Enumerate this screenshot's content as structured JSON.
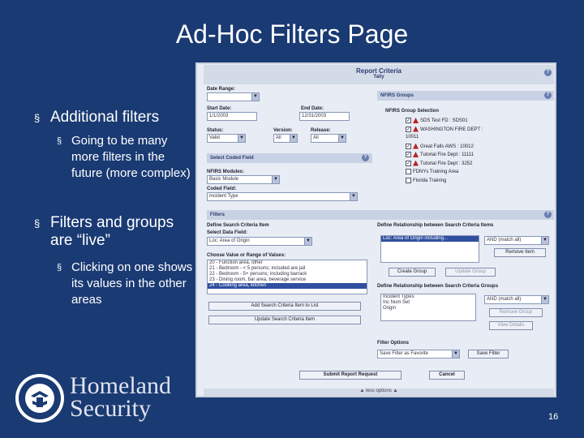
{
  "slide": {
    "title": "Ad-Hoc Filters Page",
    "bullets": [
      {
        "text": "Additional filters",
        "sub": [
          "Going to be many more filters in the future (more complex)"
        ]
      },
      {
        "text": "Filters and groups are “live”",
        "sub": [
          "Clicking on one shows its values in the other areas"
        ]
      }
    ],
    "bullet_marker": "§",
    "logo_line1": "Homeland",
    "logo_line2": "Security",
    "page_number": "16"
  },
  "app": {
    "title": "Report Criteria",
    "subtitle": "Tally",
    "help_glyph": "?",
    "dropdown_glyph": "▼",
    "checkmark": "✓",
    "left": {
      "date_range_label": "Date Range:",
      "date_range_value": "",
      "start_date_label": "Start Date:",
      "start_date_value": "1/1/2003",
      "end_date_label": "End Date:",
      "end_date_value": "12/31/2003",
      "status_label": "Status:",
      "status_value": "Valid",
      "version_label": "Version:",
      "version_value": "All",
      "release_label": "Release:",
      "release_value": "All",
      "select_coded_field": "Select Coded Field",
      "nfirs_modules_label": "NFIRS Modules:",
      "nfirs_modules_value": "Basic Module",
      "coded_field_label": "Coded Field:",
      "coded_field_value": "Incident Type"
    },
    "groups": {
      "bar": "NFIRS Groups",
      "selection_label": "NFIRS Group Selection",
      "items": [
        {
          "label": "SDS Test FD : SDS01",
          "checked": true,
          "flag": true
        },
        {
          "label": "WASHINGTON FIRE DEPT :",
          "checked": true,
          "flag": true
        },
        {
          "label": "10011",
          "checked": false,
          "flag": false
        },
        {
          "label": "Great Falls AWS : 10012",
          "checked": true,
          "flag": true
        },
        {
          "label": "Tutorial Fire Dept : 11111",
          "checked": true,
          "flag": true
        },
        {
          "label": "Tutorial Fire Dept : 3252",
          "checked": true,
          "flag": true
        },
        {
          "label": "FDNYs Training Area",
          "checked": false,
          "flag": false
        },
        {
          "label": "Florida Training",
          "checked": false,
          "flag": false
        }
      ]
    },
    "filters": {
      "bar": "Filters",
      "define_item_label": "Define Search Criteria Item",
      "select_data_field_label": "Select Data Field:",
      "select_data_field_value": "Loc: Area of Origin",
      "choose_value_label": "Choose Value or Range of Values:",
      "values": [
        "20 - Function area, other",
        "21 - Bedroom - < 5 persons; included are jail",
        "22 - Bedroom - 5+ persons; including barrack",
        "23 - Dining room, bar area, beverage service",
        "24 - Cooking area, kitchen"
      ],
      "add_button": "Add Search Criteria Item to List",
      "update_button": "Update Search Criteria Item",
      "define_rel_items_label": "Define Relationship between Search Criteria Items",
      "criteria_item": "Loc: Area of Origin including...",
      "and_match": "AND (match all)",
      "remove_item": "Remove Item",
      "create_group": "Create Group",
      "update_group": "Update Group",
      "define_rel_groups_label": "Define Relationship between Search Criteria Groups",
      "group_list": [
        "Incident Types",
        "Inc Num Set",
        "Origin"
      ],
      "remove_group": "Remove Group",
      "view_details": "View Details",
      "filter_options_label": "Filter Options",
      "filter_options_value": "Save Filter as Favorite",
      "save_filter": "Save Filter",
      "submit": "Submit Report Request",
      "cancel": "Cancel"
    },
    "footer": "▲ less options ▲"
  }
}
